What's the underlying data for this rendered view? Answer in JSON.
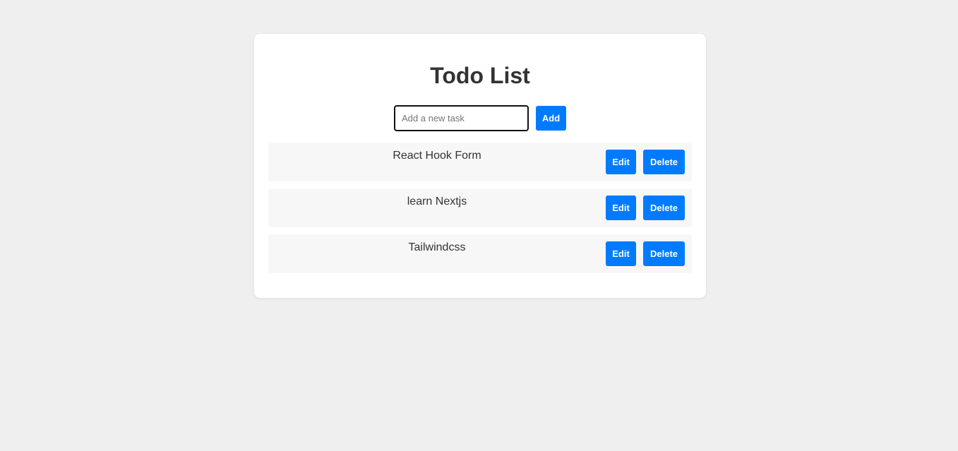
{
  "app": {
    "title": "Todo List"
  },
  "add_form": {
    "input_placeholder": "Add a new task",
    "input_value": "",
    "add_label": "Add"
  },
  "tasks": [
    {
      "text": "React Hook Form",
      "edit_label": "Edit",
      "delete_label": "Delete"
    },
    {
      "text": "learn Nextjs",
      "edit_label": "Edit",
      "delete_label": "Delete"
    },
    {
      "text": "Tailwindcss",
      "edit_label": "Edit",
      "delete_label": "Delete"
    }
  ],
  "colors": {
    "accent": "#007bff",
    "background": "#efefef",
    "card": "#ffffff",
    "task_bg": "#f7f7f7",
    "text": "#333333"
  }
}
